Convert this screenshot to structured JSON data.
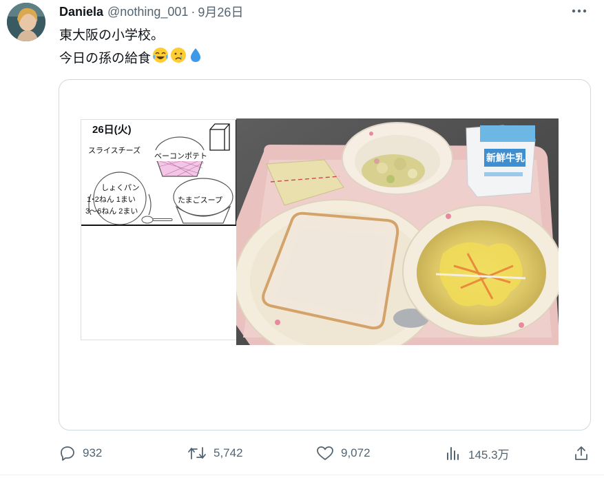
{
  "tweet": {
    "display_name": "Daniela",
    "handle": "@nothing_001",
    "separator": "·",
    "date": "9月26日",
    "text_line1": "東大阪の小学校。",
    "text_line2": "今日の孫の給食",
    "emojis": [
      "face-with-tears-of-joy",
      "crying-face",
      "droplet"
    ]
  },
  "media": {
    "menu": {
      "date": "26日(火)",
      "item_cheese": "スライスチーズ",
      "item_potato": "ベーコンポテト",
      "item_bread": "しょくパン",
      "bread_line1": "1･2ねん 1まい",
      "bread_line2": "3～6ねん 2まい",
      "item_soup": "たまごスープ"
    },
    "milk_label": "新鮮牛乳"
  },
  "actions": {
    "reply_count": "932",
    "retweet_count": "5,742",
    "like_count": "9,072",
    "views_count": "145.3万"
  },
  "colors": {
    "text_primary": "#0f1419",
    "text_secondary": "#536471",
    "border": "#cfd9de"
  }
}
